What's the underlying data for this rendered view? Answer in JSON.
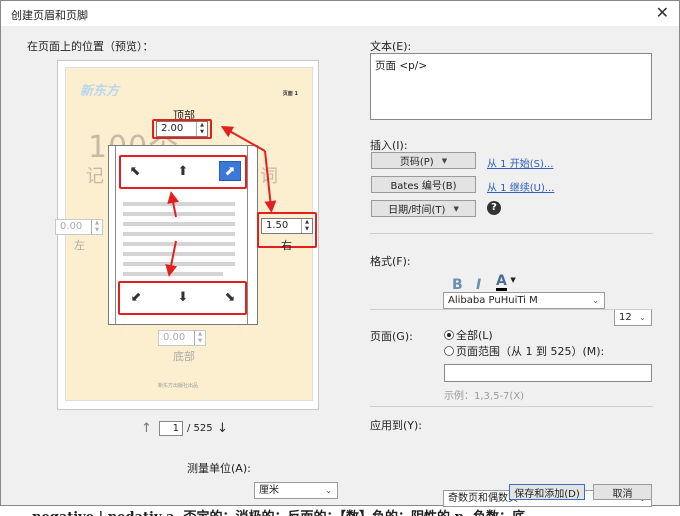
{
  "window": {
    "title": "创建页眉和页脚",
    "close_icon": "close-icon"
  },
  "preview": {
    "label": "在页面上的位置（预览）：",
    "page_number_text": "页面 1",
    "watermark_top": "新东方",
    "watermark_big": "100个",
    "watermark_mid": "记",
    "watermark_right": "词",
    "footer_small": "新东方出版社出品"
  },
  "margins": {
    "top": {
      "label": "顶部",
      "value": "2.00"
    },
    "right": {
      "label": "右",
      "value": "1.50"
    },
    "left": {
      "label": "左",
      "value": "0.00"
    },
    "bottom": {
      "label": "底部",
      "value": "0.00"
    }
  },
  "pagination": {
    "current": "1",
    "total": "/ 525"
  },
  "units": {
    "label": "测量单位(A):",
    "value": "厘米"
  },
  "text": {
    "label": "文本(E):",
    "value": "页面 <p/>"
  },
  "insert": {
    "label": "插入(I):",
    "page_code": "页码(P)",
    "start_link": "从 1 开始(S)...",
    "bates": "Bates 编号(B)",
    "continue_link": "从 1 继续(U)...",
    "datetime": "日期/时间(T)",
    "help": "?"
  },
  "format": {
    "label": "格式(F):",
    "font": "Alibaba PuHuiTi M",
    "size": "12",
    "bold": "B",
    "italic": "I",
    "color_letter": "A"
  },
  "pages": {
    "label": "页面(G):",
    "all": "全部(L)",
    "range": "页面范围（从 1 到 525）(M):",
    "example": "示例：1,3,5-7(X)"
  },
  "apply": {
    "label": "应用到(Y):",
    "value": "奇数页和偶数页"
  },
  "buttons": {
    "save": "保存和添加(D)",
    "cancel": "取消"
  },
  "background_text": "negative | nedativ a. 否定的；消极的；反面的；【数】负的；阴性的 n. 负数；底"
}
